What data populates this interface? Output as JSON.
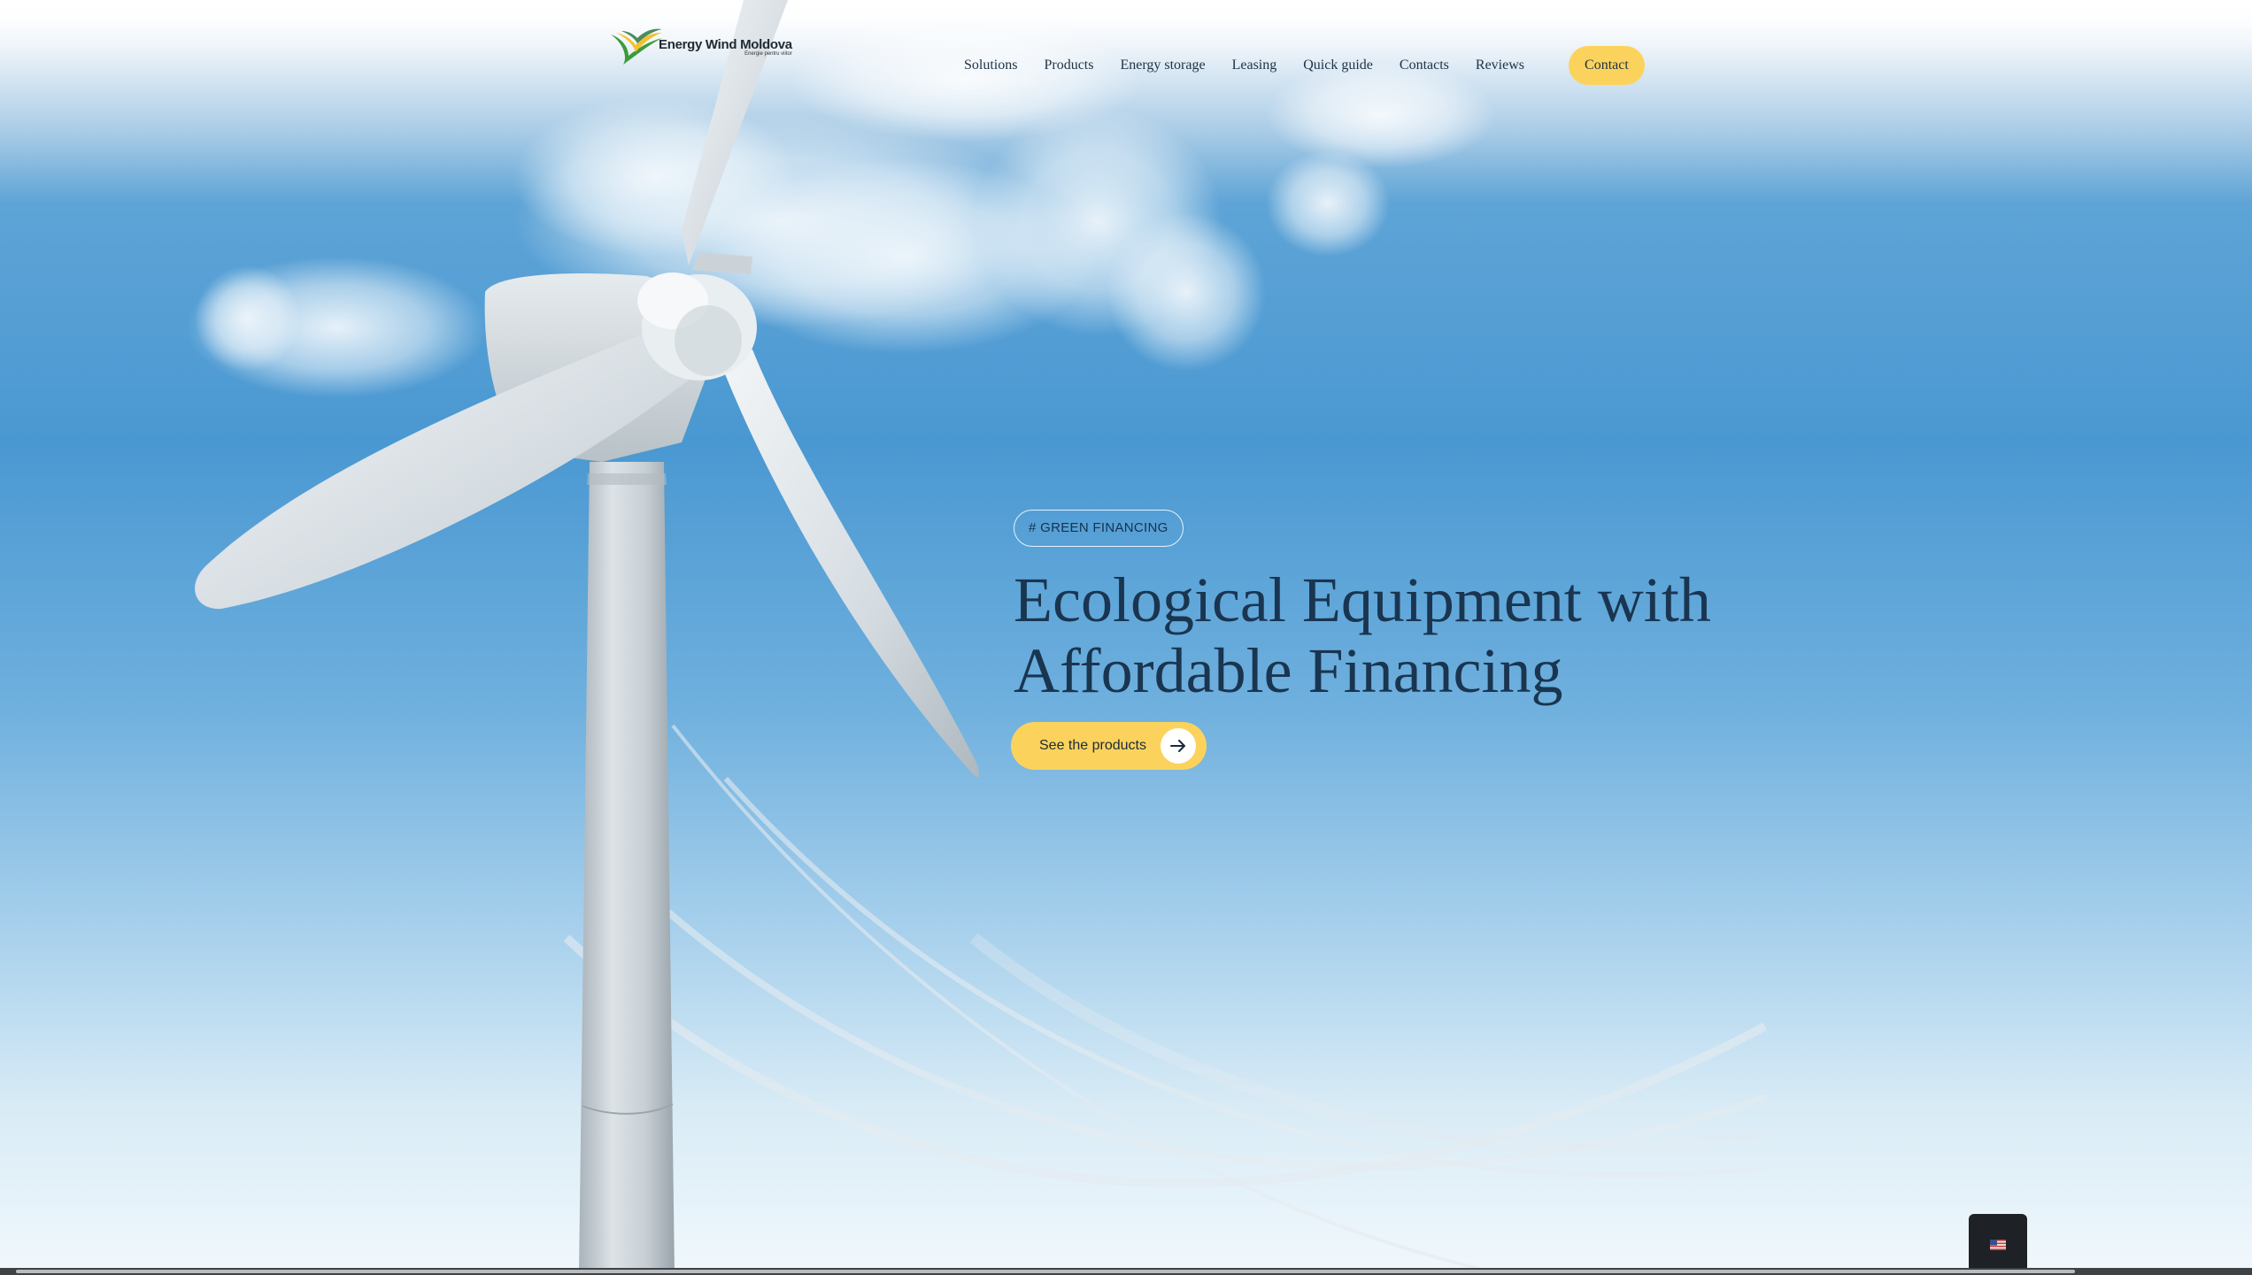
{
  "brand": {
    "name": "Energy Wind Moldova",
    "tagline": "Energie pentru viitor",
    "colors": {
      "accent_yellow": "#fbd35c",
      "text_navy": "#1a3550",
      "sky_blue": "#4a98d2"
    }
  },
  "nav": {
    "items": [
      {
        "label": "Solutions"
      },
      {
        "label": "Products"
      },
      {
        "label": "Energy storage"
      },
      {
        "label": "Leasing"
      },
      {
        "label": "Quick guide"
      },
      {
        "label": "Contacts"
      },
      {
        "label": "Reviews"
      }
    ],
    "contact_label": "Contact"
  },
  "hero": {
    "tag": "# GREEN FINANCING",
    "headline_line1": "Ecological Equipment with",
    "headline_line2": "Affordable Financing",
    "cta_label": "See the products",
    "cta_icon": "arrow-right-icon"
  },
  "language_switcher": {
    "icon": "us-flag-icon"
  }
}
